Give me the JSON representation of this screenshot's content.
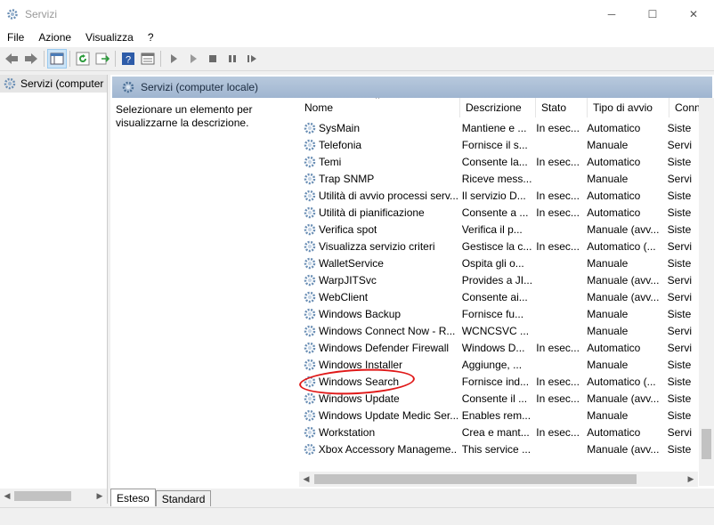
{
  "window": {
    "title": "Servizi",
    "minimize": "─",
    "maximize": "☐",
    "close": "✕"
  },
  "menu": [
    "File",
    "Azione",
    "Visualizza",
    "?"
  ],
  "tree": {
    "root_label": "Servizi (computer"
  },
  "header": {
    "title": "Servizi (computer locale)"
  },
  "description_panel": {
    "text": "Selezionare un elemento per visualizzarne la descrizione."
  },
  "columns": {
    "name": "Nome",
    "description": "Descrizione",
    "state": "Stato",
    "startup": "Tipo di avvio",
    "connect": "Conn"
  },
  "services": [
    {
      "name": "SysMain",
      "description": "Mantiene e ...",
      "state": "In esec...",
      "startup": "Automatico",
      "connect": "Siste"
    },
    {
      "name": "Telefonia",
      "description": "Fornisce il s...",
      "state": "",
      "startup": "Manuale",
      "connect": "Servi"
    },
    {
      "name": "Temi",
      "description": "Consente la...",
      "state": "In esec...",
      "startup": "Automatico",
      "connect": "Siste"
    },
    {
      "name": "Trap SNMP",
      "description": "Riceve mess...",
      "state": "",
      "startup": "Manuale",
      "connect": "Servi"
    },
    {
      "name": "Utilità di avvio processi serv...",
      "description": "Il servizio D...",
      "state": "In esec...",
      "startup": "Automatico",
      "connect": "Siste"
    },
    {
      "name": "Utilità di pianificazione",
      "description": "Consente a ...",
      "state": "In esec...",
      "startup": "Automatico",
      "connect": "Siste"
    },
    {
      "name": "Verifica spot",
      "description": "Verifica il p...",
      "state": "",
      "startup": "Manuale (avv...",
      "connect": "Siste"
    },
    {
      "name": "Visualizza servizio criteri",
      "description": "Gestisce la c...",
      "state": "In esec...",
      "startup": "Automatico (...",
      "connect": "Servi"
    },
    {
      "name": "WalletService",
      "description": "Ospita gli o...",
      "state": "",
      "startup": "Manuale",
      "connect": "Siste"
    },
    {
      "name": "WarpJITSvc",
      "description": "Provides a JI...",
      "state": "",
      "startup": "Manuale (avv...",
      "connect": "Servi"
    },
    {
      "name": "WebClient",
      "description": "Consente ai...",
      "state": "",
      "startup": "Manuale (avv...",
      "connect": "Servi"
    },
    {
      "name": "Windows Backup",
      "description": "Fornisce fu...",
      "state": "",
      "startup": "Manuale",
      "connect": "Siste"
    },
    {
      "name": "Windows Connect Now - R...",
      "description": "WCNCSVC ...",
      "state": "",
      "startup": "Manuale",
      "connect": "Servi"
    },
    {
      "name": "Windows Defender Firewall",
      "description": "Windows D...",
      "state": "In esec...",
      "startup": "Automatico",
      "connect": "Servi"
    },
    {
      "name": "Windows Installer",
      "description": "Aggiunge, ...",
      "state": "",
      "startup": "Manuale",
      "connect": "Siste"
    },
    {
      "name": "Windows Search",
      "description": "Fornisce ind...",
      "state": "In esec...",
      "startup": "Automatico (...",
      "connect": "Siste"
    },
    {
      "name": "Windows Update",
      "description": "Consente il ...",
      "state": "In esec...",
      "startup": "Manuale (avv...",
      "connect": "Siste"
    },
    {
      "name": "Windows Update Medic Ser...",
      "description": "Enables rem...",
      "state": "",
      "startup": "Manuale",
      "connect": "Siste"
    },
    {
      "name": "Workstation",
      "description": "Crea e mant...",
      "state": "In esec...",
      "startup": "Automatico",
      "connect": "Servi"
    },
    {
      "name": "Xbox Accessory Manageme...",
      "description": "This service ...",
      "state": "",
      "startup": "Manuale (avv...",
      "connect": "Siste"
    }
  ],
  "tabs": {
    "extended": "Esteso",
    "standard": "Standard"
  },
  "annotation": {
    "color": "#e01818",
    "highlighted_service": "Windows Search"
  }
}
